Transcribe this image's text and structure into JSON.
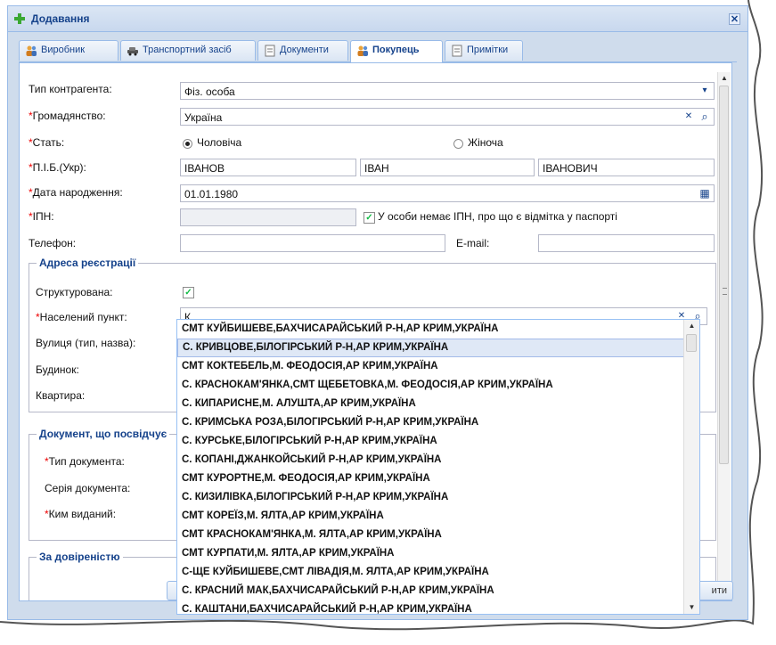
{
  "window": {
    "title": "Додавання",
    "close_glyph": "✕",
    "title_icon": "green-plus-icon"
  },
  "tabs": [
    {
      "label": "Виробник",
      "icon": "users-icon",
      "active": false
    },
    {
      "label": "Транспортний засіб",
      "icon": "car-icon",
      "active": false
    },
    {
      "label": "Документи",
      "icon": "document-icon",
      "active": false
    },
    {
      "label": "Покупець",
      "icon": "users-icon",
      "active": true
    },
    {
      "label": "Примітки",
      "icon": "document-icon",
      "active": false
    }
  ],
  "form": {
    "counterparty_type_label": "Тип контрагента:",
    "counterparty_type_value": "Фіз. особа",
    "citizenship_label": "Громадянство:",
    "citizenship_value": "Україна",
    "sex_label": "Стать:",
    "sex_male": "Чоловіча",
    "sex_female": "Жіноча",
    "name_label": "П.І.Б.(Укр):",
    "last_name": "ІВАНОВ",
    "first_name": "ІВАН",
    "middle_name": "ІВАНОВИЧ",
    "birth_date_label": "Дата народження:",
    "birth_date_value": "01.01.1980",
    "ipn_label": "ІПН:",
    "ipn_checkbox_label": "У особи немає ІПН, про що є відмітка у паспорті",
    "phone_label": "Телефон:",
    "email_label": "E-mail:",
    "required_mark": "*"
  },
  "address": {
    "legend": "Адреса реєстрації",
    "structured_label": "Структурована:",
    "settlement_label": "Населений пункт:",
    "settlement_value": "К",
    "street_label": "Вулиця (тип, назва):",
    "building_label": "Будинок:",
    "apartment_label": "Квартира:"
  },
  "document": {
    "legend": "Документ, що посвідчує",
    "doc_type_label": "Тип документа:",
    "series_label": "Серія документа:",
    "issued_by_label": "Ким виданий:"
  },
  "proxy": {
    "legend": "За довіреністю"
  },
  "combo_list": [
    "СМТ КУЙБИШЕВЕ,БАХЧИСАРАЙСЬКИЙ Р-Н,АР КРИМ,УКРАЇНА",
    "С. КРИВЦОВЕ,БІЛОГІРСЬКИЙ Р-Н,АР КРИМ,УКРАЇНА",
    "СМТ КОКТЕБЕЛЬ,М. ФЕОДОСІЯ,АР КРИМ,УКРАЇНА",
    "С. КРАСНОКАМ'ЯНКА,СМТ ЩЕБЕТОВКА,М. ФЕОДОСІЯ,АР КРИМ,УКРАЇНА",
    "С. КИПАРИСНЕ,М. АЛУШТА,АР КРИМ,УКРАЇНА",
    "С. КРИМСЬКА РОЗА,БІЛОГІРСЬКИЙ Р-Н,АР КРИМ,УКРАЇНА",
    "С. КУРСЬКЕ,БІЛОГІРСЬКИЙ Р-Н,АР КРИМ,УКРАЇНА",
    "С. КОПАНІ,ДЖАНКОЙСЬКИЙ Р-Н,АР КРИМ,УКРАЇНА",
    "СМТ КУРОРТНЕ,М. ФЕОДОСІЯ,АР КРИМ,УКРАЇНА",
    "С. КИЗИЛІВКА,БІЛОГІРСЬКИЙ Р-Н,АР КРИМ,УКРАЇНА",
    "СМТ КОРЕЇЗ,М. ЯЛТА,АР КРИМ,УКРАЇНА",
    "СМТ КРАСНОКАМ'ЯНКА,М. ЯЛТА,АР КРИМ,УКРАЇНА",
    "СМТ КУРПАТИ,М. ЯЛТА,АР КРИМ,УКРАЇНА",
    "С-ЩЕ КУЙБИШЕВЕ,СМТ ЛІВАДІЯ,М. ЯЛТА,АР КРИМ,УКРАЇНА",
    "С. КРАСНИЙ МАК,БАХЧИСАРАЙСЬКИЙ Р-Н,АР КРИМ,УКРАЇНА",
    "С. КАШТАНИ,БАХЧИСАРАЙСЬКИЙ Р-Н,АР КРИМ,УКРАЇНА"
  ],
  "combo_selected_index": 1,
  "footer": {
    "right_button_partial": "ити"
  },
  "glyphs": {
    "dropdown": "▾",
    "clear": "✕",
    "search": "⌕",
    "check": "✓",
    "scroll_up": "▲",
    "scroll_down": "▼",
    "calendar": "▦"
  },
  "colors": {
    "header_text": "#15428b",
    "border": "#99bbe8",
    "required": "#ee0000",
    "selection": "#dfe8f6"
  }
}
